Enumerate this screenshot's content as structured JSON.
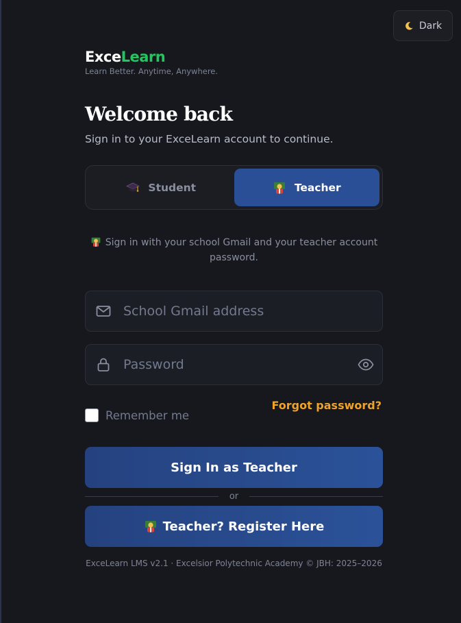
{
  "theme_toggle": {
    "label": "Dark",
    "icon": "moon-icon"
  },
  "brand": {
    "name_part1": "Exce",
    "name_part2": "Learn",
    "tagline": "Learn Better. Anytime, Anywhere."
  },
  "heading": {
    "title": "Welcome back",
    "subtitle": "Sign in to your ExceLearn account to continue."
  },
  "role_toggle": {
    "options": [
      {
        "label": "Student",
        "icon": "graduation-cap-icon",
        "selected": false
      },
      {
        "label": "Teacher",
        "icon": "teacher-icon",
        "selected": true
      }
    ]
  },
  "hint": {
    "text": "Sign in with your school Gmail and your teacher account password.",
    "icon": "teacher-icon"
  },
  "form": {
    "email_placeholder": "School Gmail address",
    "email_value": "",
    "password_placeholder": "Password",
    "password_value": "",
    "forgot_label": "Forgot password?",
    "remember_label": "Remember me",
    "remember_checked": false
  },
  "buttons": {
    "signin_label": "Sign In as Teacher",
    "divider_label": "or",
    "register_label": "Teacher? Register Here"
  },
  "footer": {
    "text": "ExceLearn LMS v2.1 · Excelsior Polytechnic Academy © JBH: 2025–2026"
  },
  "colors": {
    "background": "#16181d",
    "accent_blue": "#2a4f96",
    "brand_green": "#22c55e",
    "link_orange": "#f0a32a"
  }
}
